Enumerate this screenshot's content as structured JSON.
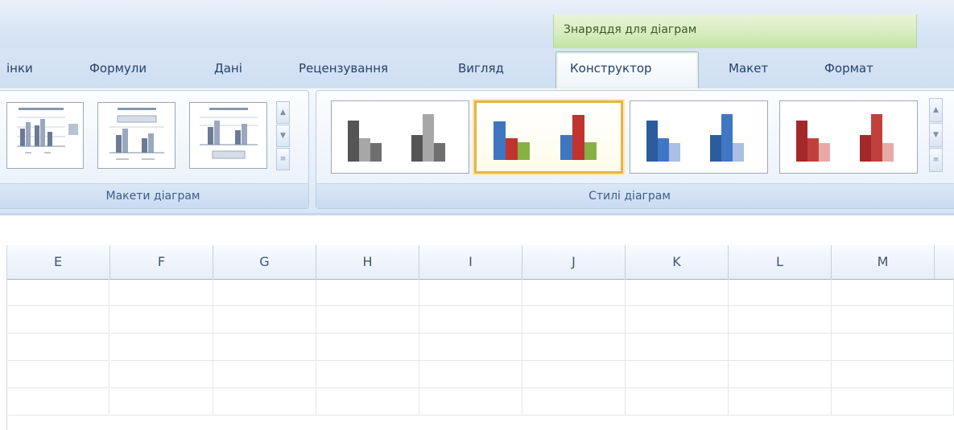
{
  "contextual_group": {
    "label": "Знаряддя для діаграм",
    "color": "#c4e2a3"
  },
  "tabs": [
    {
      "id": "insert",
      "label": "інки"
    },
    {
      "id": "formulas",
      "label": "Формули"
    },
    {
      "id": "data",
      "label": "Дані"
    },
    {
      "id": "review",
      "label": "Рецензування"
    },
    {
      "id": "view",
      "label": "Вигляд"
    },
    {
      "id": "design",
      "label": "Конструктор",
      "active": true
    },
    {
      "id": "layout",
      "label": "Макет"
    },
    {
      "id": "format",
      "label": "Формат"
    }
  ],
  "groups": {
    "chart_layouts": {
      "label": "Макети діаграм"
    },
    "chart_styles": {
      "label": "Стилі діаграм"
    }
  },
  "chart_styles": [
    {
      "name": "grayscale",
      "colors": [
        "#555555",
        "#a7a7a7",
        "#6f6f6f"
      ]
    },
    {
      "name": "colorful",
      "colors": [
        "#3f76c0",
        "#c0332f",
        "#86b244"
      ],
      "selected": true
    },
    {
      "name": "blue",
      "colors": [
        "#2c5b9e",
        "#3f77c3",
        "#a9bfe3"
      ]
    },
    {
      "name": "red",
      "colors": [
        "#a3282a",
        "#c2403c",
        "#e6a9a6"
      ]
    }
  ],
  "columns": [
    "E",
    "F",
    "G",
    "H",
    "I",
    "J",
    "K",
    "L",
    "M"
  ],
  "scroll_icons": [
    "scroll-up-icon",
    "scroll-down-icon",
    "expand-more-icon"
  ],
  "accent_gold": "#e3b44d"
}
